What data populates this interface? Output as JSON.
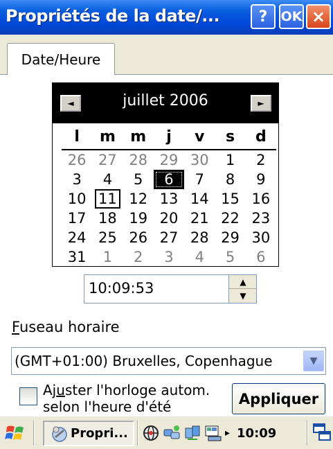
{
  "window": {
    "title": "Propriétés de la date/...",
    "help_label": "?",
    "ok_label": "OK",
    "close_label": "×"
  },
  "tabs": [
    {
      "label": "Date/Heure"
    }
  ],
  "calendar": {
    "month_label": "juillet 2006",
    "prev_icon": "◄",
    "next_icon": "►",
    "day_headers": [
      "l",
      "m",
      "m",
      "j",
      "v",
      "s",
      "d"
    ],
    "weeks": [
      [
        "26",
        "27",
        "28",
        "29",
        "30",
        "1",
        "2"
      ],
      [
        "3",
        "4",
        "5",
        "6",
        "7",
        "8",
        "9"
      ],
      [
        "10",
        "11",
        "12",
        "13",
        "14",
        "15",
        "16"
      ],
      [
        "17",
        "18",
        "19",
        "20",
        "21",
        "22",
        "23"
      ],
      [
        "24",
        "25",
        "26",
        "27",
        "28",
        "29",
        "30"
      ],
      [
        "31",
        "1",
        "2",
        "3",
        "4",
        "5",
        "6"
      ]
    ],
    "selected_day": "6",
    "today_day": "11"
  },
  "time": {
    "value": "10:09:53"
  },
  "timezone": {
    "label_accel": "F",
    "label_rest": "useau horaire",
    "value": "(GMT+01:00) Bruxelles, Copenhague"
  },
  "dst": {
    "label_line1_a": "Aj",
    "label_line1_accel": "u",
    "label_line1_b": "ster l'horloge autom.",
    "label_line2": "selon l'heure d'été",
    "checked": false
  },
  "apply_button": {
    "label": "Appliquer"
  },
  "taskbar": {
    "task_label": "Propri...",
    "clock": "10:09",
    "tray_arrow": "▸"
  }
}
